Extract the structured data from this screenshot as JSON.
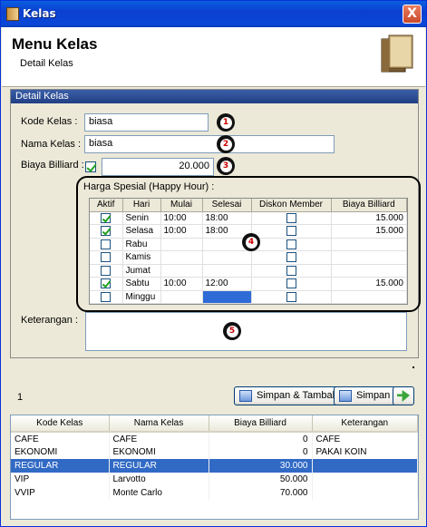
{
  "window": {
    "title": "Kelas",
    "close": "X"
  },
  "header": {
    "title": "Menu Kelas",
    "subtitle": "Detail Kelas"
  },
  "panel": {
    "title": "Detail Kelas"
  },
  "form": {
    "kode_label": "Kode Kelas :",
    "kode_value": "biasa",
    "nama_label": "Nama Kelas :",
    "nama_value": "biasa",
    "biaya_label": "Biaya Billiard :",
    "biaya_checked": true,
    "biaya_value": "20.000",
    "happy_label": "Harga Spesial (Happy Hour) :",
    "keterangan_label": "Keterangan :",
    "keterangan_value": ""
  },
  "markers": [
    "1",
    "2",
    "3",
    "4",
    "5"
  ],
  "happy_hour": {
    "columns": [
      "Aktif",
      "Hari",
      "Mulai",
      "Selesai",
      "Diskon Member",
      "Biaya Billiard"
    ],
    "rows": [
      {
        "aktif": true,
        "hari": "Senin",
        "mulai": "10:00",
        "selesai": "18:00",
        "diskon": false,
        "biaya": "15.000"
      },
      {
        "aktif": true,
        "hari": "Selasa",
        "mulai": "10:00",
        "selesai": "18:00",
        "diskon": false,
        "biaya": "15.000"
      },
      {
        "aktif": false,
        "hari": "Rabu",
        "mulai": "",
        "selesai": "",
        "diskon": false,
        "biaya": ""
      },
      {
        "aktif": false,
        "hari": "Kamis",
        "mulai": "",
        "selesai": "",
        "diskon": false,
        "biaya": ""
      },
      {
        "aktif": false,
        "hari": "Jumat",
        "mulai": "",
        "selesai": "",
        "diskon": false,
        "biaya": ""
      },
      {
        "aktif": true,
        "hari": "Sabtu",
        "mulai": "10:00",
        "selesai": "12:00",
        "diskon": false,
        "biaya": "15.000"
      },
      {
        "aktif": false,
        "hari": "Minggu",
        "mulai": "",
        "selesai": "",
        "diskon": false,
        "biaya": ""
      }
    ]
  },
  "toolbar": {
    "counter": "1",
    "save_add_label": "Simpan & Tambah",
    "save_label": "Simpan"
  },
  "list": {
    "columns": [
      "Kode Kelas",
      "Nama Kelas",
      "Biaya Billiard",
      "Keterangan"
    ],
    "rows": [
      {
        "kode": "CAFE",
        "nama": "CAFE",
        "biaya": "0",
        "ket": "CAFE"
      },
      {
        "kode": "EKONOMI",
        "nama": "EKONOMI",
        "biaya": "0",
        "ket": "PAKAI KOIN"
      },
      {
        "kode": "REGULAR",
        "nama": "REGULAR",
        "biaya": "30.000",
        "ket": ""
      },
      {
        "kode": "VIP",
        "nama": "Larvotto",
        "biaya": "50.000",
        "ket": ""
      },
      {
        "kode": "VVIP",
        "nama": "Monte Carlo",
        "biaya": "70.000",
        "ket": ""
      }
    ],
    "selected_index": 2
  }
}
